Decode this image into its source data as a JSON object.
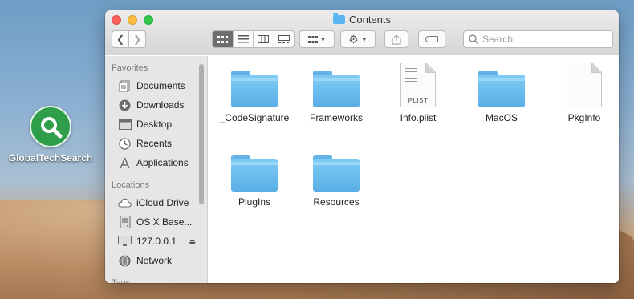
{
  "desktop": {
    "icon_label": "GlobalTechSearch"
  },
  "window": {
    "title": "Contents",
    "toolbar": {
      "search_placeholder": "Search"
    }
  },
  "sidebar": {
    "favorites_heading": "Favorites",
    "favorites": [
      {
        "label": "Documents",
        "icon": "documents-icon"
      },
      {
        "label": "Downloads",
        "icon": "downloads-icon"
      },
      {
        "label": "Desktop",
        "icon": "desktop-icon"
      },
      {
        "label": "Recents",
        "icon": "recents-icon"
      },
      {
        "label": "Applications",
        "icon": "applications-icon"
      }
    ],
    "locations_heading": "Locations",
    "locations": [
      {
        "label": "iCloud Drive",
        "icon": "icloud-icon"
      },
      {
        "label": "OS X Base...",
        "icon": "disk-icon"
      },
      {
        "label": "127.0.0.1",
        "icon": "display-icon",
        "ejectable": true
      },
      {
        "label": "Network",
        "icon": "network-icon"
      }
    ],
    "tags_heading": "Tags"
  },
  "files": [
    {
      "name": "_CodeSignature",
      "kind": "folder"
    },
    {
      "name": "Frameworks",
      "kind": "folder"
    },
    {
      "name": "Info.plist",
      "kind": "document",
      "badge": "PLIST"
    },
    {
      "name": "MacOS",
      "kind": "folder"
    },
    {
      "name": "PkgInfo",
      "kind": "document"
    },
    {
      "name": "PlugIns",
      "kind": "folder"
    },
    {
      "name": "Resources",
      "kind": "folder"
    }
  ],
  "colors": {
    "folder": "#5aaee6",
    "close": "#fc605b",
    "minimize": "#fdbc40",
    "maximize": "#34c84a",
    "app_icon": "#2f9e4a"
  }
}
